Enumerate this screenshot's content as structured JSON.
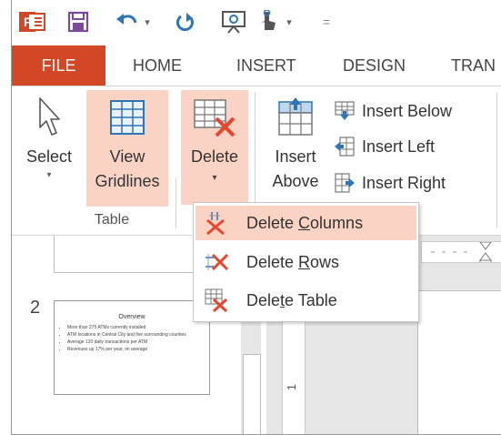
{
  "qat": {
    "icons": [
      "powerpoint-logo-icon",
      "save-icon",
      "undo-icon",
      "customize-arrow-icon",
      "redo-icon",
      "slideshow-icon",
      "touch-mode-icon",
      "customize-arrow-icon",
      "overflow-icon"
    ]
  },
  "tabs": [
    {
      "label": "FILE"
    },
    {
      "label": "HOME"
    },
    {
      "label": "INSERT"
    },
    {
      "label": "DESIGN"
    },
    {
      "label": "TRAN"
    }
  ],
  "ribbon": {
    "select": {
      "label": "Select"
    },
    "view_gridlines": {
      "line1": "View",
      "line2": "Gridlines"
    },
    "delete": {
      "label": "Delete"
    },
    "insert_above": {
      "line1": "Insert",
      "line2": "Above"
    },
    "insert_below": {
      "label": "Insert Below"
    },
    "insert_left": {
      "label": "Insert Left"
    },
    "insert_right": {
      "label": "Insert Right"
    },
    "group_label": "Table"
  },
  "delete_menu": {
    "items": [
      {
        "label_pre": "Delete ",
        "label_key": "C",
        "label_post": "olumns"
      },
      {
        "label_pre": "Delete ",
        "label_key": "R",
        "label_post": "ows"
      },
      {
        "label_pre": "Dele",
        "label_key": "t",
        "label_post": "e Table"
      }
    ]
  },
  "slide_panel": {
    "slide_number": "2",
    "thumbnail": {
      "title": "Overview",
      "bullets": [
        "More than 275 ATMs currently installed",
        "ATM locations in Central City and five surrounding counties",
        "Average 120 daily transactions per ATM",
        "Revenues up 17% per year, on average"
      ]
    }
  },
  "ruler": {
    "mark": "1"
  },
  "colors": {
    "accent": "#d24726",
    "highlight": "#fbd3c4",
    "icon_blue": "#2e75b6",
    "delete_red": "#e8462d"
  }
}
